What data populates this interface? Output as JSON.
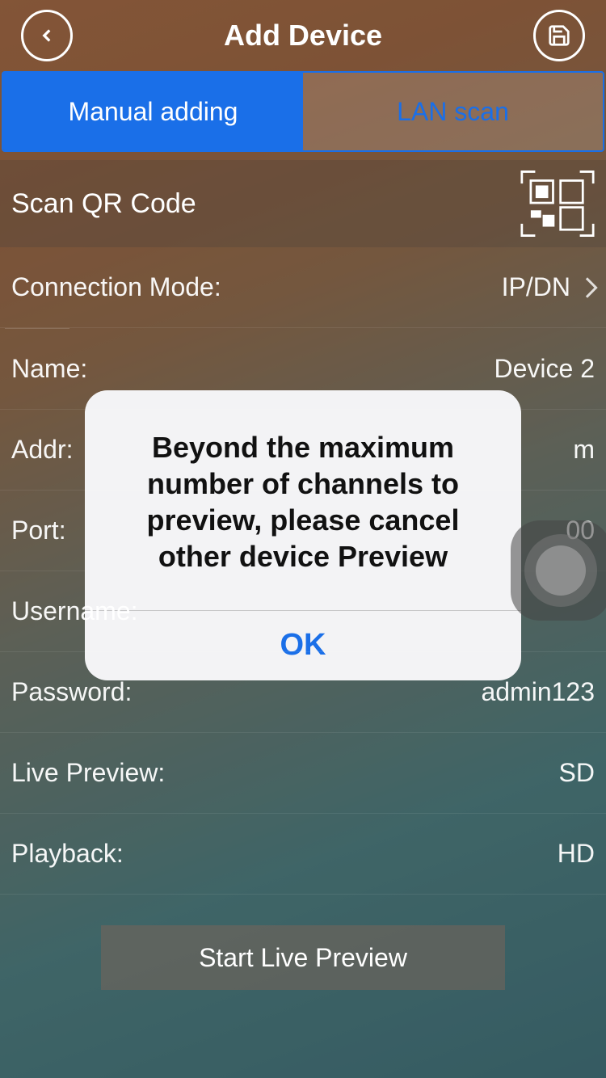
{
  "header": {
    "title": "Add Device"
  },
  "tabs": {
    "manual": "Manual adding",
    "lan": "LAN scan"
  },
  "scan_qr_label": "Scan QR Code",
  "rows": {
    "connection_mode": {
      "label": "Connection Mode:",
      "value": "IP/DN"
    },
    "name": {
      "label": "Name:",
      "value": "Device 2"
    },
    "addr": {
      "label": "Addr:",
      "value": "m"
    },
    "port": {
      "label": "Port:",
      "value": "00"
    },
    "username": {
      "label": "Username:",
      "value": ""
    },
    "password": {
      "label": "Password:",
      "value": "admin123"
    },
    "live_preview": {
      "label": "Live Preview:",
      "value": "SD"
    },
    "playback": {
      "label": "Playback:",
      "value": "HD"
    }
  },
  "start_button": "Start Live Preview",
  "dialog": {
    "message": "Beyond the maximum number of channels to preview, please cancel other device Preview",
    "ok": "OK"
  }
}
